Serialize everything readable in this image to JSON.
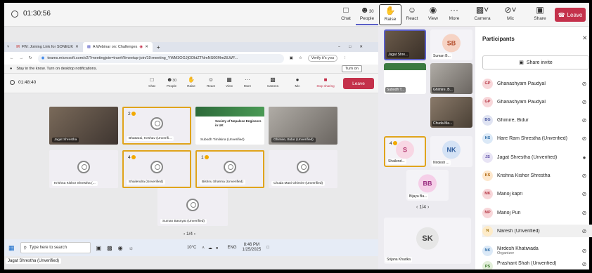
{
  "topbar": {
    "timer": "01:30:56",
    "buttons": [
      {
        "icon": "chat-icon",
        "label": "Chat"
      },
      {
        "icon": "people-icon",
        "label": "People",
        "count": "30"
      },
      {
        "icon": "hand-icon",
        "label": "Raise"
      },
      {
        "icon": "react-icon",
        "label": "React"
      },
      {
        "icon": "view-icon",
        "label": "View"
      },
      {
        "icon": "more-icon",
        "label": "More"
      },
      {
        "icon": "camera-off-icon",
        "label": "Camera"
      },
      {
        "icon": "mic-off-icon",
        "label": "Mic"
      },
      {
        "icon": "share-icon",
        "label": "Share"
      }
    ],
    "leave": "Leave"
  },
  "shared": {
    "tabs": [
      {
        "label": "FW: Joining Link for SONEUK"
      },
      {
        "label": "A Webinar on: Challenges"
      }
    ],
    "url": "teams.microsoft.com/v2/?meetingjoin=true#/l/meetup-join/19:meeting_YWM3OGJjODktZTNmNS00MmZiLWF...",
    "verify": "Verify it's you",
    "notification": "Stay in the know. Turn on desktop notifications.",
    "turn_on": "Turn on",
    "timer": "01:48:40",
    "people_count": "30",
    "buttons": [
      "Chat",
      "People",
      "Raise",
      "React",
      "View",
      "More",
      "Camera",
      "Mic",
      "Stop sharing"
    ],
    "leave": "Leave",
    "tiles": [
      {
        "name": "Jagat Shrestha"
      },
      {
        "name": "Bhattarai, Keshav (Unverifi...",
        "count": "2"
      },
      {
        "name": "Subodh Timilsina (Unverified)",
        "banner": "Society of Nepalese Engineers in UK"
      },
      {
        "name": "Ghimire, Bidur (Unverified)"
      },
      {
        "name": "Krishna Kishor Shrestha (..."
      },
      {
        "name": "Shailendra (Unverified)",
        "count": "4"
      },
      {
        "name": "Bishnu Sharma (Unverified)",
        "count": "1"
      },
      {
        "name": "Chuda Mani Ghimire (Unverified)"
      },
      {
        "name": "Suman Basnyat (Unverified)"
      }
    ],
    "pager": "1/4",
    "taskbar": {
      "search": "Type here to search",
      "temp": "10°C",
      "lang": "ENG",
      "time": "8:46 PM",
      "date": "1/25/2025"
    },
    "self_name": "Jagat Shrestha (Unverified)"
  },
  "strip": {
    "tiles": [
      {
        "name": "Jagat Shre...",
        "initials": ""
      },
      {
        "name": "Suman B...",
        "initials": "SB",
        "color": "#f6d3c4",
        "text": "#b4502f"
      },
      {
        "name": "Subodh T...",
        "initials": ""
      },
      {
        "name": "Ghimire, B...",
        "initials": ""
      },
      {
        "name": "Chuda Ma...",
        "initials": ""
      },
      {
        "name": "Shailend...",
        "initials": "S",
        "count": "4",
        "color": "#f8d7e4",
        "text": "#b02e68"
      },
      {
        "name": "Nirdesh ...",
        "initials": "NK",
        "color": "#d4e2f5",
        "text": "#2d5a9b"
      },
      {
        "name": "Bijaya Ba...",
        "initials": "BB",
        "color": "#f5cfe8",
        "text": "#9a2e80"
      },
      {
        "name": "Srijana Khadka",
        "initials": "SK",
        "color": "#e6e6e6",
        "text": "#444"
      }
    ],
    "pager": "1/4"
  },
  "panel": {
    "title": "Participants",
    "share_invite": "Share invite",
    "participants": [
      {
        "initials": "GP",
        "name": "Ghanashyam Paudyal",
        "color": "#f8d7da",
        "text": "#b53b48",
        "mic": "muted"
      },
      {
        "initials": "GP",
        "name": "Ghanashyam Paudyal",
        "color": "#f8d7da",
        "text": "#b53b48",
        "mic": "muted"
      },
      {
        "initials": "BG",
        "name": "Ghimire, Bidur",
        "color": "#dfe3f2",
        "text": "#4a58a0",
        "mic": "muted"
      },
      {
        "initials": "HS",
        "name": "Hare Ram Shrestha (Unverified)",
        "color": "#dbe9f7",
        "text": "#2f6ea8",
        "mic": "muted"
      },
      {
        "initials": "JS",
        "name": "Jagat Shrestha (Unverified)",
        "color": "#e8e4f5",
        "text": "#5a4aa3",
        "mic": "on"
      },
      {
        "initials": "KS",
        "name": "Krishna Kishor Shrestha",
        "color": "#fde7cc",
        "text": "#b0660f",
        "mic": "muted"
      },
      {
        "initials": "MK",
        "name": "Manoj kapri",
        "color": "#f8d7da",
        "text": "#b53b48",
        "mic": "muted"
      },
      {
        "initials": "MP",
        "name": "Manoj Pun",
        "color": "#f8d7da",
        "text": "#b53b48",
        "mic": "muted"
      },
      {
        "initials": "N",
        "name": "Naresh (Unverified)",
        "color": "#fdebc8",
        "text": "#a0700a",
        "mic": "muted"
      },
      {
        "initials": "NK",
        "name": "Nirdesh Khatiwada",
        "sub": "Organizer",
        "color": "#dbe9f7",
        "text": "#2f6ea8",
        "mic": "muted"
      },
      {
        "initials": "PS",
        "name": "Prashant Shah (Unverified)",
        "color": "#e2efd9",
        "text": "#3b7a2a",
        "mic": "muted"
      }
    ]
  }
}
